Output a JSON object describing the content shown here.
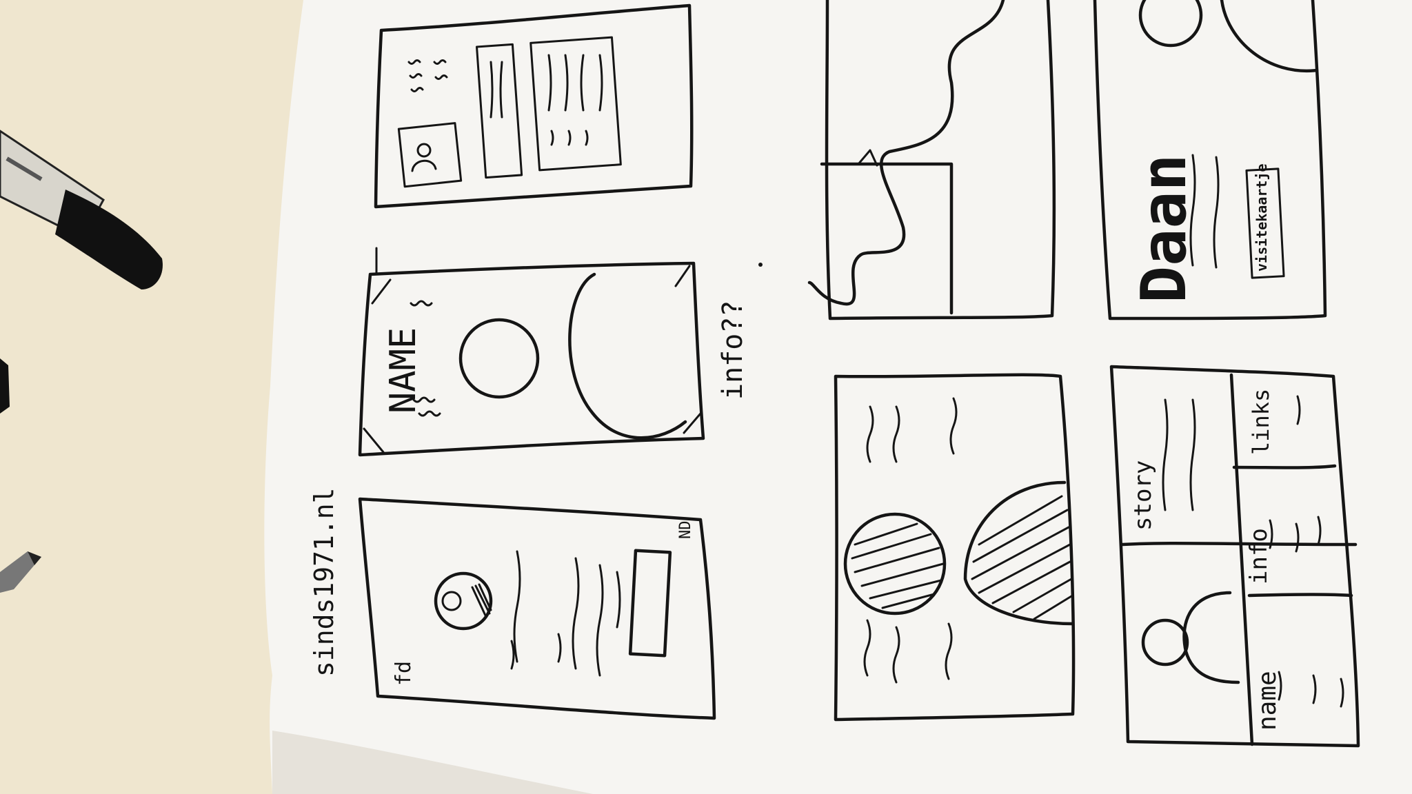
{
  "sketchbook": {
    "site_label": "sinds1971.nl",
    "corner_fd": "fd",
    "corner_nd": "ND",
    "name_card_label": "NAME",
    "info_question": "info??",
    "signature_word": "Daan",
    "business_card_button": "visitekaartje",
    "panel_story": "story",
    "panel_links": "links",
    "panel_info": "info",
    "panel_name": "name"
  },
  "colors": {
    "desk": "#efe6cf",
    "paper": "#f6f5f2",
    "ink": "#151515"
  }
}
